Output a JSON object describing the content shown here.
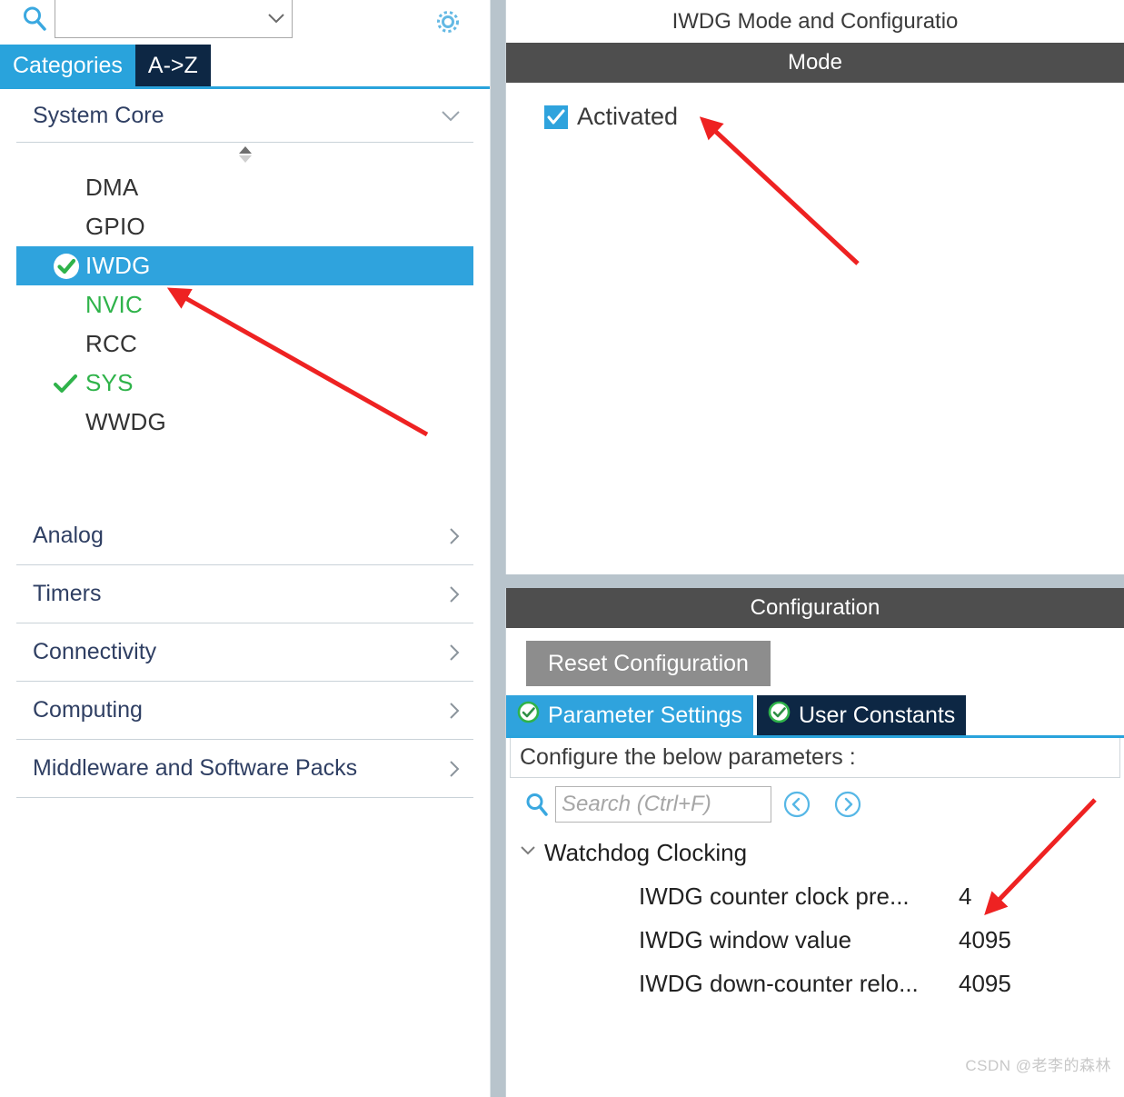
{
  "left": {
    "search": {
      "icon": "search-icon",
      "value": "",
      "placeholder": "",
      "chevron": "chevron-down-icon"
    },
    "settings_icon": "gear-icon",
    "tabs": [
      {
        "label": "Categories",
        "active": true
      },
      {
        "label": "A->Z",
        "active": false
      }
    ],
    "group": {
      "title": "System Core",
      "chevron": "chevron-down-icon",
      "items": [
        {
          "label": "DMA",
          "state": "none",
          "selected": false
        },
        {
          "label": "GPIO",
          "state": "none",
          "selected": false
        },
        {
          "label": "IWDG",
          "state": "check-circle",
          "selected": true
        },
        {
          "label": "NVIC",
          "state": "green-text",
          "selected": false
        },
        {
          "label": "RCC",
          "state": "none",
          "selected": false
        },
        {
          "label": "SYS",
          "state": "check",
          "selected": false
        },
        {
          "label": "WWDG",
          "state": "none",
          "selected": false
        }
      ]
    },
    "categories": [
      {
        "label": "Analog",
        "chevron": "chevron-right-icon"
      },
      {
        "label": "Timers",
        "chevron": "chevron-right-icon"
      },
      {
        "label": "Connectivity",
        "chevron": "chevron-right-icon"
      },
      {
        "label": "Computing",
        "chevron": "chevron-right-icon"
      },
      {
        "label": "Middleware and Software Packs",
        "chevron": "chevron-right-icon"
      }
    ]
  },
  "right": {
    "title": "IWDG Mode and Configuratio",
    "mode": {
      "band_label": "Mode",
      "checkbox": {
        "label": "Activated",
        "checked": true
      }
    },
    "configuration": {
      "band_label": "Configuration",
      "reset_button": "Reset Configuration",
      "tabs": [
        {
          "label": "Parameter Settings",
          "active": true,
          "icon": "check-circle-icon"
        },
        {
          "label": "User Constants",
          "active": false,
          "icon": "check-circle-icon"
        }
      ],
      "note": "Configure the below parameters :",
      "search": {
        "icon": "search-icon",
        "value": "",
        "placeholder": "Search (Ctrl+F)",
        "prev_icon": "chevron-left-circle-icon",
        "next_icon": "chevron-right-circle-icon"
      },
      "tree": {
        "group_label": "Watchdog Clocking",
        "group_chevron": "chevron-down-icon",
        "rows": [
          {
            "name": "IWDG counter clock pre...",
            "value": "4"
          },
          {
            "name": "IWDG window value",
            "value": "4095"
          },
          {
            "name": "IWDG down-counter relo...",
            "value": "4095"
          }
        ]
      }
    }
  },
  "watermark": "CSDN @老李的森林",
  "colors": {
    "accent_blue": "#2fa3dd",
    "tab_navy": "#0d2744",
    "band_gray": "#4e4e4e",
    "splitter": "#b8c4cc",
    "green": "#2fb34a",
    "reset_gray": "#8d8d8d",
    "arrow_red": "#ee2222"
  }
}
